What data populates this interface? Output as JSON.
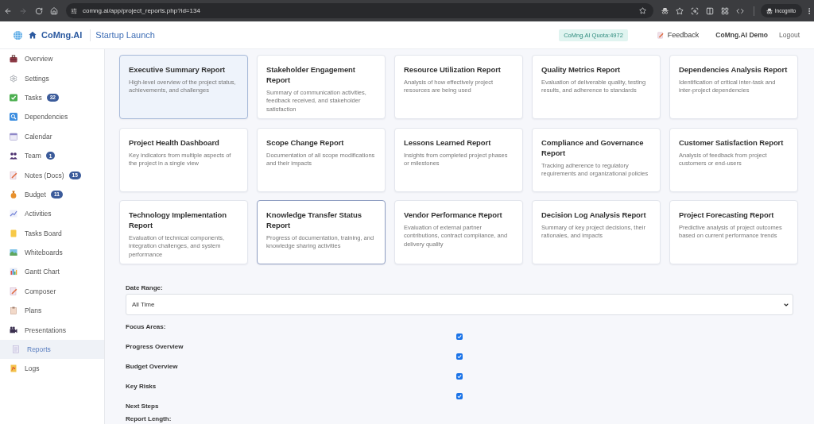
{
  "browser": {
    "url": "comng.ai/app/project_reports.php?id=134",
    "profile": "Incognito"
  },
  "header": {
    "brand": "CoMng.AI",
    "project": "Startup Launch",
    "quota": "CoMng.AI Quota:4972",
    "feedback": "Feedback",
    "user": "CoMng.AI Demo",
    "logout": "Logout"
  },
  "sidebar": {
    "items": [
      {
        "label": "Overview",
        "selected": false
      },
      {
        "label": "Settings",
        "selected": false
      },
      {
        "label": "Tasks",
        "badge": "32",
        "selected": false
      },
      {
        "label": "Dependencies",
        "selected": false
      },
      {
        "label": "Calendar",
        "selected": false
      },
      {
        "label": "Team",
        "badge": "1",
        "selected": false
      },
      {
        "label": "Notes (Docs)",
        "badge": "15",
        "selected": false
      },
      {
        "label": "Budget",
        "badge": "11",
        "selected": false
      },
      {
        "label": "Activities",
        "selected": false
      },
      {
        "label": "Tasks Board",
        "selected": false
      },
      {
        "label": "Whiteboards",
        "selected": false
      },
      {
        "label": "Gantt Chart",
        "selected": false
      },
      {
        "label": "Composer",
        "selected": false
      },
      {
        "label": "Plans",
        "selected": false
      },
      {
        "label": "Presentations",
        "selected": false
      },
      {
        "label": "Reports",
        "selected": true
      },
      {
        "label": "Logs",
        "selected": false
      }
    ]
  },
  "report_types": [
    {
      "title": "Executive Summary Report",
      "description": "High-level overview of the project status, achievements, and challenges",
      "selected": true,
      "hovered": false
    },
    {
      "title": "Stakeholder Engagement Report",
      "description": "Summary of communication activities, feedback received, and stakeholder satisfaction",
      "selected": false,
      "hovered": false
    },
    {
      "title": "Resource Utilization Report",
      "description": "Analysis of how effectively project resources are being used",
      "selected": false,
      "hovered": false
    },
    {
      "title": "Quality Metrics Report",
      "description": "Evaluation of deliverable quality, testing results, and adherence to standards",
      "selected": false,
      "hovered": false
    },
    {
      "title": "Dependencies Analysis Report",
      "description": "Identification of critical inter-task and inter-project dependencies",
      "selected": false,
      "hovered": false
    },
    {
      "title": "Project Health Dashboard",
      "description": "Key indicators from multiple aspects of the project in a single view",
      "selected": false,
      "hovered": false
    },
    {
      "title": "Scope Change Report",
      "description": "Documentation of all scope modifications and their impacts",
      "selected": false,
      "hovered": false
    },
    {
      "title": "Lessons Learned Report",
      "description": "Insights from completed project phases or milestones",
      "selected": false,
      "hovered": false
    },
    {
      "title": "Compliance and Governance Report",
      "description": "Tracking adherence to regulatory requirements and organizational policies",
      "selected": false,
      "hovered": false
    },
    {
      "title": "Customer Satisfaction Report",
      "description": "Analysis of feedback from project customers or end-users",
      "selected": false,
      "hovered": false
    },
    {
      "title": "Technology Implementation Report",
      "description": "Evaluation of technical components, integration challenges, and system performance",
      "selected": false,
      "hovered": false
    },
    {
      "title": "Knowledge Transfer Status Report",
      "description": "Progress of documentation, training, and knowledge sharing activities",
      "selected": false,
      "hovered": true
    },
    {
      "title": "Vendor Performance Report",
      "description": "Evaluation of external partner contributions, contract compliance, and delivery quality",
      "selected": false,
      "hovered": false
    },
    {
      "title": "Decision Log Analysis Report",
      "description": "Summary of key project decisions, their rationales, and impacts",
      "selected": false,
      "hovered": false
    },
    {
      "title": "Project Forecasting Report",
      "description": "Predictive analysis of project outcomes based on current performance trends",
      "selected": false,
      "hovered": false
    }
  ],
  "form": {
    "date_range": {
      "label": "Date Range:",
      "value": "All Time"
    },
    "focus_areas": {
      "label": "Focus Areas:",
      "items": [
        {
          "label": "Progress Overview",
          "checked": true
        },
        {
          "label": "Budget Overview",
          "checked": true
        },
        {
          "label": "Key Risks",
          "checked": true
        },
        {
          "label": "Next Steps",
          "checked": true
        }
      ]
    },
    "report_length": {
      "label": "Report Length:"
    }
  }
}
